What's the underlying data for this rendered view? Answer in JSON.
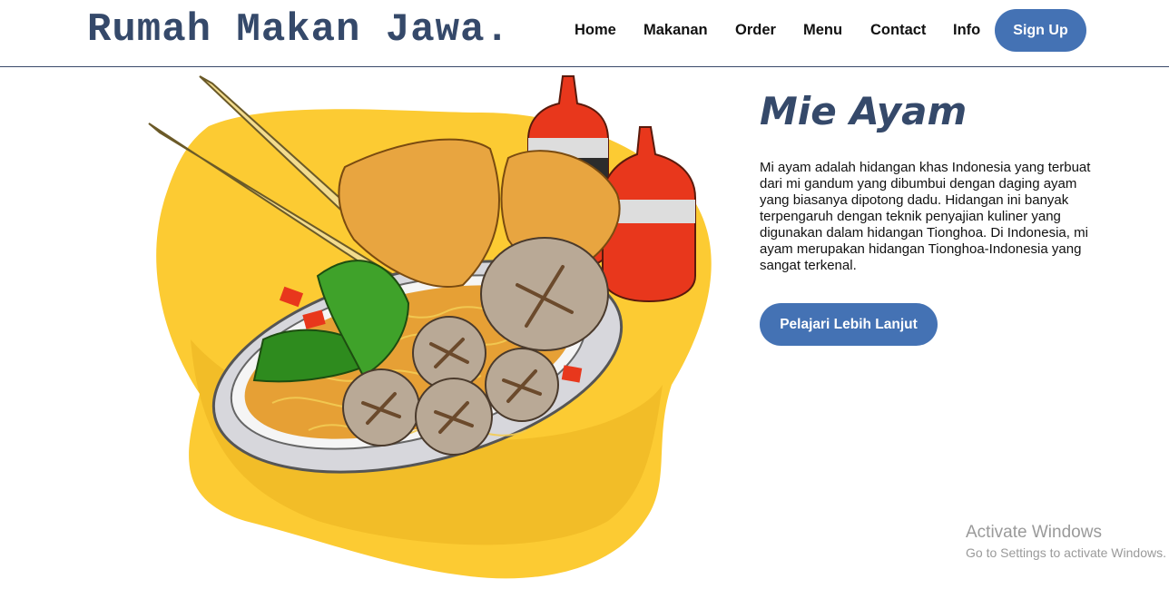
{
  "nav": {
    "brand": "Rumah Makan Jawa.",
    "links": [
      "Home",
      "Makanan",
      "Order",
      "Menu",
      "Contact",
      "Info"
    ],
    "signup_label": "Sign Up"
  },
  "hero": {
    "title": "Mie Ayam",
    "description": "Mi ayam adalah hidangan khas Indonesia yang terbuat dari mi gandum yang dibumbui dengan daging ayam yang biasanya dipotong dadu. Hidangan ini banyak terpengaruh dengan teknik penyajian kuliner yang digunakan dalam hidangan Tionghoa. Di Indonesia, mi ayam merupakan hidangan Tionghoa-Indonesia yang sangat terkenal.",
    "cta_label": "Pelajari Lebih Lanjut",
    "illustration": "mie-ayam-bowl-illustration"
  },
  "watermark": {
    "title": "Activate Windows",
    "subtitle": "Go to Settings to activate Windows."
  },
  "colors": {
    "accent": "#4472b4",
    "brand": "#35496a",
    "blob": "#fccb33",
    "sauce": "#e8371c"
  }
}
